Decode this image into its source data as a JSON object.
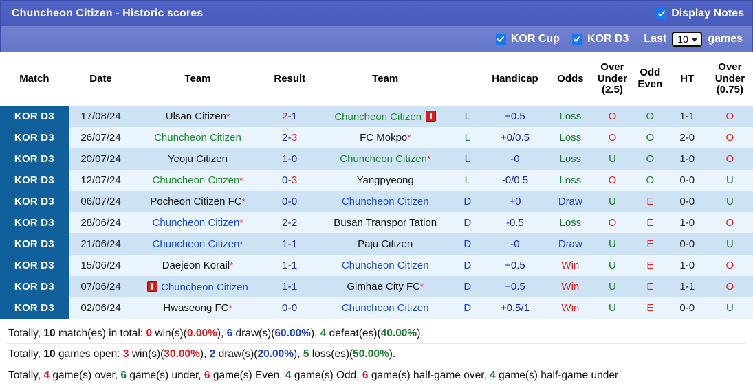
{
  "header": {
    "title": "Chuncheon Citizen - Historic scores",
    "display_notes_label": "Display Notes",
    "display_notes_checked": true,
    "checkbox_icon": "check-icon"
  },
  "filters": {
    "kor_cup_label": "KOR Cup",
    "kor_cup_checked": true,
    "kor_d3_label": "KOR D3",
    "kor_d3_checked": true,
    "last_label": "Last",
    "games_label": "games",
    "last_games_value": "10",
    "caret_icon": "chevron-down-icon"
  },
  "table": {
    "columns": [
      "Match",
      "Date",
      "Team",
      "Result",
      "Team",
      "",
      "Handicap",
      "Odds",
      "Over Under (2.5)",
      "Odd Even",
      "HT",
      "Over Under (0.75)"
    ],
    "headers": {
      "match": "Match",
      "date": "Date",
      "team_home": "Team",
      "result": "Result",
      "team_away": "Team",
      "handicap": "Handicap",
      "odds": "Odds",
      "over_under_25_l1": "Over",
      "over_under_25_l2": "Under",
      "over_under_25_l3": "(2.5)",
      "odd_even_l1": "Odd",
      "odd_even_l2": "Even",
      "ht": "HT",
      "over_under_075_l1": "Over",
      "over_under_075_l2": "Under",
      "over_under_075_l3": "(0.75)"
    },
    "rows": [
      {
        "match": "KOR D3",
        "date": "17/08/24",
        "home": "Ulsan Citizen",
        "home_color": "neutral",
        "home_star": true,
        "home_card": false,
        "score_a": "2",
        "score_b": "1",
        "score_a_color": "red",
        "score_b_color": "blue",
        "away": "Chuncheon Citizen",
        "away_color": "green",
        "away_star": false,
        "away_card": true,
        "outcome": "L",
        "outcome_color": "green",
        "handicap": "+0.5",
        "odds": "Loss",
        "odds_color": "green",
        "ou25": "O",
        "ou25_color": "red",
        "oddeven": "O",
        "oddeven_color": "green",
        "ht": "1-1",
        "ou075": "O",
        "ou075_color": "red"
      },
      {
        "match": "KOR D3",
        "date": "26/07/24",
        "home": "Chuncheon Citizen",
        "home_color": "green",
        "home_star": false,
        "home_card": false,
        "score_a": "2",
        "score_b": "3",
        "score_a_color": "blue",
        "score_b_color": "red",
        "away": "FC Mokpo",
        "away_color": "neutral",
        "away_star": true,
        "away_card": false,
        "outcome": "L",
        "outcome_color": "green",
        "handicap": "+0/0.5",
        "odds": "Loss",
        "odds_color": "green",
        "ou25": "O",
        "ou25_color": "red",
        "oddeven": "O",
        "oddeven_color": "green",
        "ht": "2-0",
        "ou075": "O",
        "ou075_color": "red"
      },
      {
        "match": "KOR D3",
        "date": "20/07/24",
        "home": "Yeoju Citizen",
        "home_color": "neutral",
        "home_star": false,
        "home_card": false,
        "score_a": "1",
        "score_b": "0",
        "score_a_color": "red",
        "score_b_color": "blue",
        "away": "Chuncheon Citizen",
        "away_color": "green",
        "away_star": true,
        "away_card": false,
        "outcome": "L",
        "outcome_color": "green",
        "handicap": "-0",
        "odds": "Loss",
        "odds_color": "green",
        "ou25": "U",
        "ou25_color": "green",
        "oddeven": "O",
        "oddeven_color": "green",
        "ht": "1-0",
        "ou075": "O",
        "ou075_color": "red"
      },
      {
        "match": "KOR D3",
        "date": "12/07/24",
        "home": "Chuncheon Citizen",
        "home_color": "green",
        "home_star": true,
        "home_card": false,
        "score_a": "0",
        "score_b": "3",
        "score_a_color": "blue",
        "score_b_color": "red",
        "away": "Yangpyeong",
        "away_color": "neutral",
        "away_star": false,
        "away_card": false,
        "outcome": "L",
        "outcome_color": "green",
        "handicap": "-0/0.5",
        "odds": "Loss",
        "odds_color": "green",
        "ou25": "O",
        "ou25_color": "red",
        "oddeven": "O",
        "oddeven_color": "green",
        "ht": "0-0",
        "ou075": "U",
        "ou075_color": "green"
      },
      {
        "match": "KOR D3",
        "date": "06/07/24",
        "home": "Pocheon Citizen FC",
        "home_color": "neutral",
        "home_star": true,
        "home_card": false,
        "score_a": "0",
        "score_b": "0",
        "score_a_color": "blue",
        "score_b_color": "blue",
        "away": "Chuncheon Citizen",
        "away_color": "blue",
        "away_star": false,
        "away_card": false,
        "outcome": "D",
        "outcome_color": "blue",
        "handicap": "+0",
        "odds": "Draw",
        "odds_color": "blue",
        "ou25": "U",
        "ou25_color": "green",
        "oddeven": "E",
        "oddeven_color": "red",
        "ht": "0-0",
        "ou075": "U",
        "ou075_color": "green"
      },
      {
        "match": "KOR D3",
        "date": "28/06/24",
        "home": "Chuncheon Citizen",
        "home_color": "blue",
        "home_star": true,
        "home_card": false,
        "score_a": "2",
        "score_b": "2",
        "score_a_color": "blue",
        "score_b_color": "blue",
        "away": "Busan Transpor Tation",
        "away_color": "neutral",
        "away_star": false,
        "away_card": false,
        "outcome": "D",
        "outcome_color": "blue",
        "handicap": "-0.5",
        "odds": "Loss",
        "odds_color": "green",
        "ou25": "O",
        "ou25_color": "red",
        "oddeven": "E",
        "oddeven_color": "red",
        "ht": "1-0",
        "ou075": "O",
        "ou075_color": "red"
      },
      {
        "match": "KOR D3",
        "date": "21/06/24",
        "home": "Chuncheon Citizen",
        "home_color": "blue",
        "home_star": true,
        "home_card": false,
        "score_a": "1",
        "score_b": "1",
        "score_a_color": "blue",
        "score_b_color": "blue",
        "away": "Paju Citizen",
        "away_color": "neutral",
        "away_star": false,
        "away_card": false,
        "outcome": "D",
        "outcome_color": "blue",
        "handicap": "-0",
        "odds": "Draw",
        "odds_color": "blue",
        "ou25": "U",
        "ou25_color": "green",
        "oddeven": "E",
        "oddeven_color": "red",
        "ht": "0-0",
        "ou075": "U",
        "ou075_color": "green"
      },
      {
        "match": "KOR D3",
        "date": "15/06/24",
        "home": "Daejeon Korail",
        "home_color": "neutral",
        "home_star": true,
        "home_card": false,
        "score_a": "1",
        "score_b": "1",
        "score_a_color": "blue",
        "score_b_color": "blue",
        "away": "Chuncheon Citizen",
        "away_color": "blue",
        "away_star": false,
        "away_card": false,
        "outcome": "D",
        "outcome_color": "blue",
        "handicap": "+0.5",
        "odds": "Win",
        "odds_color": "red",
        "ou25": "U",
        "ou25_color": "green",
        "oddeven": "E",
        "oddeven_color": "red",
        "ht": "1-0",
        "ou075": "O",
        "ou075_color": "red"
      },
      {
        "match": "KOR D3",
        "date": "07/06/24",
        "home": "Chuncheon Citizen",
        "home_color": "blue",
        "home_star": false,
        "home_card": true,
        "score_a": "1",
        "score_b": "1",
        "score_a_color": "blue",
        "score_b_color": "blue",
        "away": "Gimhae City FC",
        "away_color": "neutral",
        "away_star": true,
        "away_card": false,
        "outcome": "D",
        "outcome_color": "blue",
        "handicap": "+0.5",
        "odds": "Win",
        "odds_color": "red",
        "ou25": "U",
        "ou25_color": "green",
        "oddeven": "E",
        "oddeven_color": "red",
        "ht": "1-1",
        "ou075": "O",
        "ou075_color": "red"
      },
      {
        "match": "KOR D3",
        "date": "02/06/24",
        "home": "Hwaseong FC",
        "home_color": "neutral",
        "home_star": true,
        "home_card": false,
        "score_a": "0",
        "score_b": "0",
        "score_a_color": "blue",
        "score_b_color": "blue",
        "away": "Chuncheon Citizen",
        "away_color": "blue",
        "away_star": false,
        "away_card": false,
        "outcome": "D",
        "outcome_color": "blue",
        "handicap": "+0.5/1",
        "odds": "Win",
        "odds_color": "red",
        "ou25": "U",
        "ou25_color": "green",
        "oddeven": "E",
        "oddeven_color": "red",
        "ht": "0-0",
        "ou075": "U",
        "ou075_color": "green"
      }
    ]
  },
  "notes": {
    "line1": {
      "t1": "Totally, ",
      "v1": "10",
      "t2": " match(es) in total: ",
      "v2": "0",
      "t3": " win(s)(",
      "v3": "0.00%",
      "t4": "), ",
      "v4": "6",
      "t5": " draw(s)(",
      "v5": "60.00%",
      "t6": "), ",
      "v6": "4",
      "t7": " defeat(es)(",
      "v7": "40.00%",
      "t8": ")."
    },
    "line2": {
      "t1": "Totally, ",
      "v1": "10",
      "t2": " games open: ",
      "v2": "3",
      "t3": " win(s)(",
      "v3": "30.00%",
      "t4": "), ",
      "v4": "2",
      "t5": " draw(s)(",
      "v5": "20.00%",
      "t6": "), ",
      "v6": "5",
      "t7": " loss(es)(",
      "v7": "50.00%",
      "t8": ")."
    },
    "line3": {
      "t1": "Totally, ",
      "v1": "4",
      "t2": " game(s) over, ",
      "v2": "6",
      "t3": " game(s) under, ",
      "v3": "6",
      "t4": " game(s) Even, ",
      "v4": "4",
      "t5": " game(s) Odd, ",
      "v5": "6",
      "t6": " game(s) half-game over, ",
      "v6": "4",
      "t7": " game(s) half-game under"
    }
  },
  "colors": {
    "titlebar": "#4a5cbd",
    "filterbar": "#6576c9",
    "match_badge": "#10619b",
    "row_odd": "#cde3f4",
    "row_even": "#e9f4fc",
    "green": "#1d7a2b",
    "red": "#e32020",
    "blue": "#1b3fd0"
  }
}
